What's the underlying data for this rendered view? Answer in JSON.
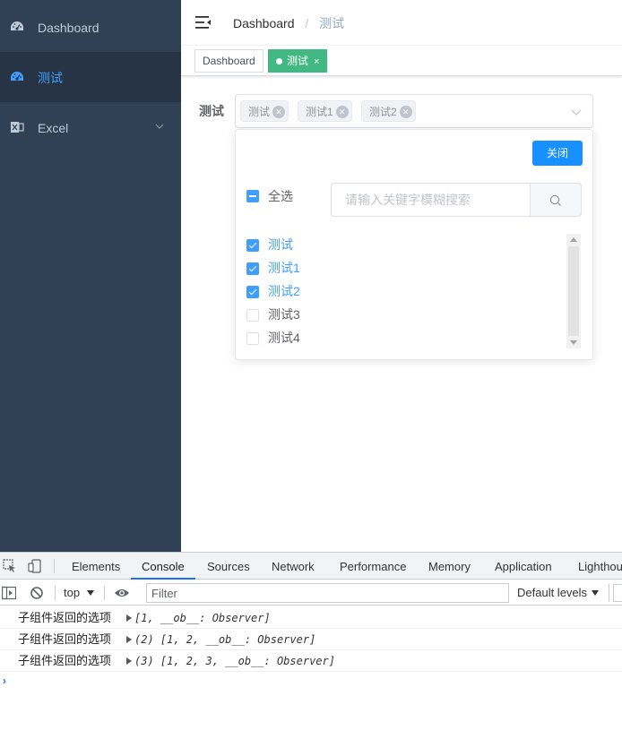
{
  "sidebar": {
    "items": [
      {
        "label": "Dashboard",
        "icon": "dashboard-icon"
      },
      {
        "label": "测试",
        "icon": "dashboard-icon",
        "active": true
      },
      {
        "label": "Excel",
        "icon": "excel-icon",
        "has_children": true
      }
    ]
  },
  "navbar": {
    "breadcrumb": [
      "Dashboard",
      "测试"
    ],
    "separator": "/"
  },
  "tags_view": {
    "tags": [
      {
        "label": "Dashboard"
      },
      {
        "label": "测试",
        "active": true,
        "close": "×"
      }
    ]
  },
  "form": {
    "label": "测试",
    "selected_chips": [
      "测试",
      "测试1",
      "测试2"
    ]
  },
  "dropdown": {
    "close_button": "关闭",
    "select_all_label": "全选",
    "search_placeholder": "请输入关键字模糊搜索",
    "options": [
      {
        "label": "测试",
        "checked": true
      },
      {
        "label": "测试1",
        "checked": true
      },
      {
        "label": "测试2",
        "checked": true
      },
      {
        "label": "测试3",
        "checked": false
      },
      {
        "label": "测试4",
        "checked": false
      }
    ]
  },
  "devtools": {
    "tabs": [
      "Elements",
      "Console",
      "Sources",
      "Network",
      "Performance",
      "Memory",
      "Application",
      "Lighthouse"
    ],
    "active_tab": "Console",
    "context": "top",
    "filter_placeholder": "Filter",
    "levels": "Default levels",
    "logs": [
      {
        "message": "子组件返回的选项",
        "object": "[1, __ob__: Observer]"
      },
      {
        "message": "子组件返回的选项",
        "object": "(2) [1, 2, __ob__: Observer]"
      },
      {
        "message": "子组件返回的选项",
        "object": "(3) [1, 2, 3, __ob__: Observer]"
      }
    ],
    "prompt": "›"
  },
  "colors": {
    "sidebar_bg": "#304156",
    "sidebar_active_bg": "#263445",
    "primary": "#409eff",
    "tag_active": "#42b983",
    "close_button": "#1890ff"
  }
}
